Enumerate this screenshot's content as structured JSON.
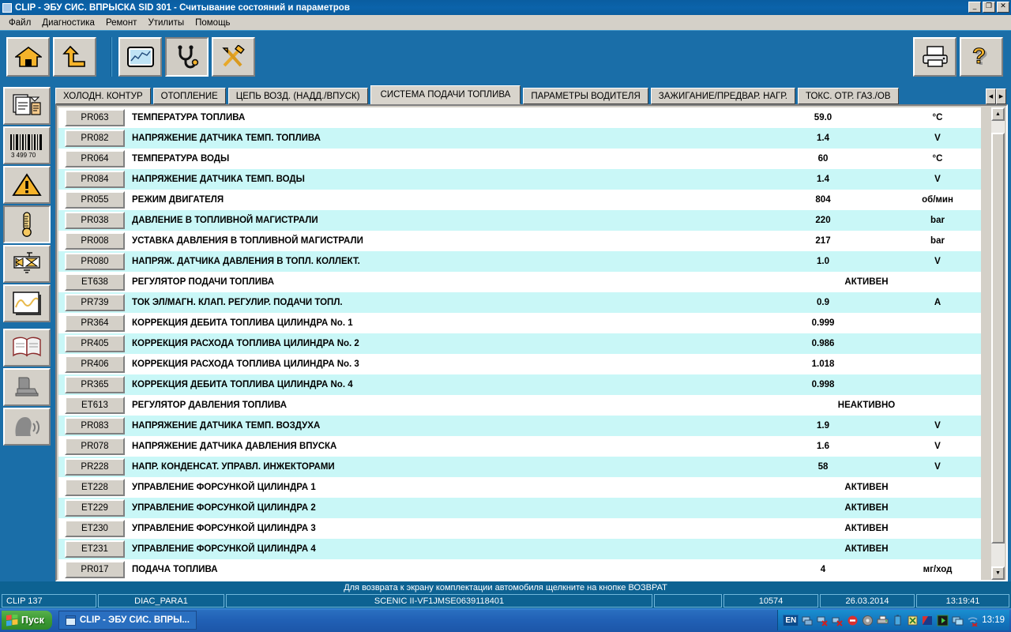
{
  "window": {
    "title": "CLIP - ЭБУ СИС. ВПРЫСКА SID 301 - Считывание состояний и параметров",
    "minimize": "_",
    "maximize": "❐",
    "close": "✕"
  },
  "menu": {
    "items": [
      {
        "label": "Файл"
      },
      {
        "label": "Диагностика"
      },
      {
        "label": "Ремонт"
      },
      {
        "label": "Утилиты"
      },
      {
        "label": "Помощь"
      }
    ]
  },
  "toolbar": {
    "left_buttons": [
      {
        "name": "home-icon",
        "label": ""
      },
      {
        "name": "back-up-arrow-icon",
        "label": ""
      }
    ],
    "mid_buttons": [
      {
        "name": "chart-monitor-icon",
        "label": ""
      },
      {
        "name": "stethoscope-icon",
        "label": ""
      },
      {
        "name": "tools-hammer-wrench-icon",
        "label": ""
      }
    ],
    "right_buttons": [
      {
        "name": "printer-icon",
        "label": ""
      },
      {
        "name": "help-question-icon",
        "label": ""
      }
    ]
  },
  "sidebar": {
    "items": [
      {
        "name": "documents-copy-icon"
      },
      {
        "name": "barcode-icon",
        "label": "3 499 70"
      },
      {
        "name": "warning-triangle-icon"
      },
      {
        "name": "thermometer-icon"
      },
      {
        "name": "actuator-valve-icon"
      },
      {
        "name": "waveform-graph-icon"
      },
      {
        "name": "book-icon"
      },
      {
        "name": "seat-icon"
      },
      {
        "name": "voice-head-icon"
      }
    ]
  },
  "tabs": {
    "items": [
      {
        "label": "ХОЛОДН. КОНТУР",
        "active": false
      },
      {
        "label": "ОТОПЛЕНИЕ",
        "active": false
      },
      {
        "label": "ЦЕПЬ ВОЗД. (НАДД./ВПУСК)",
        "active": false
      },
      {
        "label": "СИСТЕМА ПОДАЧИ ТОПЛИВА",
        "active": true
      },
      {
        "label": "ПАРАМЕТРЫ ВОДИТЕЛЯ",
        "active": false
      },
      {
        "label": "ЗАЖИГАНИЕ/ПРЕДВАР. НАГР.",
        "active": false
      },
      {
        "label": "ТОКС. ОТР. ГАЗ./ОВ",
        "active": false
      }
    ],
    "scroll_left": "◀",
    "scroll_right": "▶"
  },
  "table": {
    "rows": [
      {
        "id": "PR063",
        "label": "ТЕМПЕРАТУРА ТОПЛИВА",
        "value": "59.0",
        "unit": "°C",
        "state": ""
      },
      {
        "id": "PR082",
        "label": "НАПРЯЖЕНИЕ ДАТЧИКА ТЕМП. ТОПЛИВА",
        "value": "1.4",
        "unit": "V",
        "state": ""
      },
      {
        "id": "PR064",
        "label": "ТЕМПЕРАТУРА ВОДЫ",
        "value": "60",
        "unit": "°C",
        "state": ""
      },
      {
        "id": "PR084",
        "label": "НАПРЯЖЕНИЕ ДАТЧИКА ТЕМП. ВОДЫ",
        "value": "1.4",
        "unit": "V",
        "state": ""
      },
      {
        "id": "PR055",
        "label": "РЕЖИМ ДВИГАТЕЛЯ",
        "value": "804",
        "unit": "об/мин",
        "state": ""
      },
      {
        "id": "PR038",
        "label": "ДАВЛЕНИЕ В ТОПЛИВНОЙ МАГИСТРАЛИ",
        "value": "220",
        "unit": "bar",
        "state": ""
      },
      {
        "id": "PR008",
        "label": "УСТАВКА ДАВЛЕНИЯ В ТОПЛИВНОЙ МАГИСТРАЛИ",
        "value": "217",
        "unit": "bar",
        "state": ""
      },
      {
        "id": "PR080",
        "label": "НАПРЯЖ. ДАТЧИКА ДАВЛЕНИЯ В ТОПЛ. КОЛЛЕКТ.",
        "value": "1.0",
        "unit": "V",
        "state": ""
      },
      {
        "id": "ET638",
        "label": "РЕГУЛЯТОР ПОДАЧИ ТОПЛИВА",
        "value": "",
        "unit": "",
        "state": "АКТИВЕН"
      },
      {
        "id": "PR739",
        "label": "ТОК ЭЛ/МАГН. КЛАП. РЕГУЛИР. ПОДАЧИ ТОПЛ.",
        "value": "0.9",
        "unit": "A",
        "state": ""
      },
      {
        "id": "PR364",
        "label": "КОРРЕКЦИЯ ДЕБИТА ТОПЛИВА ЦИЛИНДРА No. 1",
        "value": "0.999",
        "unit": "",
        "state": ""
      },
      {
        "id": "PR405",
        "label": "КОРРЕКЦИЯ РАСХОДА ТОПЛИВА ЦИЛИНДРА No. 2",
        "value": "0.986",
        "unit": "",
        "state": ""
      },
      {
        "id": "PR406",
        "label": "КОРРЕКЦИЯ РАСХОДА ТОПЛИВА ЦИЛИНДРА No. 3",
        "value": "1.018",
        "unit": "",
        "state": ""
      },
      {
        "id": "PR365",
        "label": "КОРРЕКЦИЯ ДЕБИТА ТОПЛИВА ЦИЛИНДРА No. 4",
        "value": "0.998",
        "unit": "",
        "state": ""
      },
      {
        "id": "ET613",
        "label": "РЕГУЛЯТОР ДАВЛЕНИЯ ТОПЛИВА",
        "value": "",
        "unit": "",
        "state": "НЕАКТИВНО"
      },
      {
        "id": "PR083",
        "label": "НАПРЯЖЕНИЕ ДАТЧИКА ТЕМП. ВОЗДУХА",
        "value": "1.9",
        "unit": "V",
        "state": ""
      },
      {
        "id": "PR078",
        "label": "НАПРЯЖЕНИЕ ДАТЧИКА ДАВЛЕНИЯ ВПУСКА",
        "value": "1.6",
        "unit": "V",
        "state": ""
      },
      {
        "id": "PR228",
        "label": "НАПР. КОНДЕНСАТ. УПРАВЛ. ИНЖЕКТОРАМИ",
        "value": "58",
        "unit": "V",
        "state": ""
      },
      {
        "id": "ET228",
        "label": "УПРАВЛЕНИЕ ФОРСУНКОЙ ЦИЛИНДРА 1",
        "value": "",
        "unit": "",
        "state": "АКТИВЕН"
      },
      {
        "id": "ET229",
        "label": "УПРАВЛЕНИЕ ФОРСУНКОЙ ЦИЛИНДРА 2",
        "value": "",
        "unit": "",
        "state": "АКТИВЕН"
      },
      {
        "id": "ET230",
        "label": "УПРАВЛЕНИЕ ФОРСУНКОЙ ЦИЛИНДРА 3",
        "value": "",
        "unit": "",
        "state": "АКТИВЕН"
      },
      {
        "id": "ET231",
        "label": "УПРАВЛЕНИЕ ФОРСУНКОЙ ЦИЛИНДРА 4",
        "value": "",
        "unit": "",
        "state": "АКТИВЕН"
      },
      {
        "id": "PR017",
        "label": "ПОДАЧА ТОПЛИВА",
        "value": "4",
        "unit": "мг/ход",
        "state": ""
      }
    ]
  },
  "hint": {
    "text": "Для возврата к экрану комплектации автомобиля щелкните на кнопке ВОЗВРАТ"
  },
  "status": {
    "clip": "CLIP 137",
    "session": "DIAC_PARA1",
    "vin": "SCENIC II-VF1JMSE0639118401",
    "blank": "",
    "counter": "10574",
    "date": "26.03.2014",
    "time": "13:19:41"
  },
  "taskbar": {
    "start": "Пуск",
    "task": "CLIP - ЭБУ СИС. ВПРЫ...",
    "lang": "EN",
    "clock": "13:19"
  }
}
